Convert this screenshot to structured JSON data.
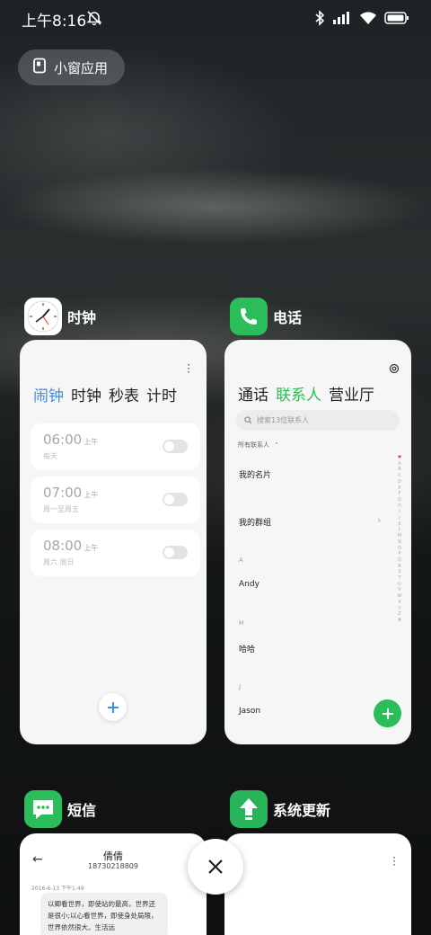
{
  "status_bar": {
    "time": "上午8:16",
    "icons": [
      "mute-icon",
      "bluetooth-icon",
      "signal-icon",
      "wifi-icon",
      "battery-icon"
    ]
  },
  "small_window": {
    "label": "小窗应用",
    "icon": "small-window-icon"
  },
  "apps": [
    {
      "name": "时钟",
      "tabs": [
        "闹钟",
        "时钟",
        "秒表",
        "计时"
      ],
      "active_tab": "闹钟",
      "alarms": [
        {
          "time": "06:00",
          "ampm": "上午",
          "repeat": "每天"
        },
        {
          "time": "07:00",
          "ampm": "上午",
          "repeat": "周一至周五"
        },
        {
          "time": "08:00",
          "ampm": "上午",
          "repeat": "周六 周日"
        }
      ]
    },
    {
      "name": "电话",
      "tabs": [
        "通话",
        "联系人",
        "营业厅"
      ],
      "active_tab": "联系人",
      "search_placeholder": "搜索13位联系人",
      "filter": "所有联系人",
      "my_card": "我的名片",
      "my_groups": "我的群组",
      "sections": [
        {
          "letter": "A",
          "name": "Andy"
        },
        {
          "letter": "H",
          "name": "哈哈"
        },
        {
          "letter": "J",
          "name": "Jason"
        }
      ],
      "alphabet": [
        "♥",
        "A",
        "B",
        "C",
        "D",
        "E",
        "F",
        "G",
        "H",
        "I",
        "J",
        "K",
        "L",
        "M",
        "N",
        "O",
        "P",
        "Q",
        "R",
        "S",
        "T",
        "U",
        "V",
        "W",
        "X",
        "Y",
        "Z",
        "#"
      ]
    },
    {
      "name": "短信",
      "contact_name": "倩倩",
      "contact_number": "18730218809",
      "message_time": "2016-6-13 下午1:49",
      "message_text": "以卿看世界，即使站的最高，世界还是很小;以心看世界，即使身处局限，世界依然很大。生活远"
    },
    {
      "name": "系统更新"
    }
  ],
  "colors": {
    "clock_accent": "#3a8ee6",
    "phone_accent": "#2bbd59",
    "messages_green": "#2bbd59",
    "update_green": "#29b35a"
  }
}
